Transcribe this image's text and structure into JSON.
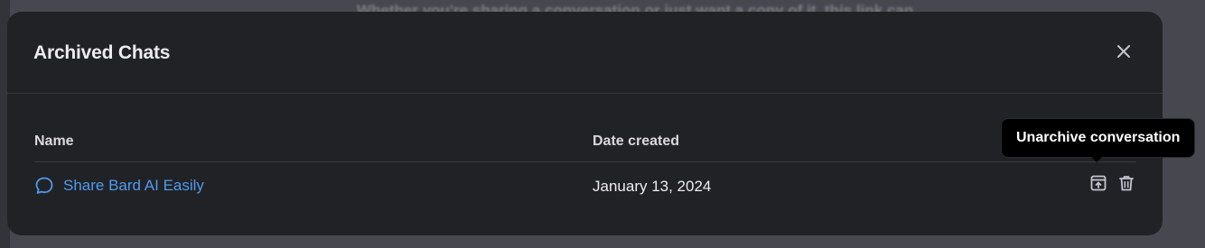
{
  "backdrop": {
    "text": "Whether you're sharing a conversation or just want a copy of it, this link can"
  },
  "modal": {
    "title": "Archived Chats",
    "close_icon": "close-icon"
  },
  "table": {
    "columns": [
      "Name",
      "Date created"
    ],
    "rows": [
      {
        "name": "Share Bard AI Easily",
        "date_created": "January 13, 2024",
        "icon": "chat-bubble-icon"
      }
    ]
  },
  "actions": {
    "unarchive_icon": "unarchive-icon",
    "delete_icon": "trash-icon"
  },
  "tooltip": {
    "text": "Unarchive conversation"
  },
  "colors": {
    "link": "#4d9bef",
    "modal_bg": "#212225",
    "tooltip_bg": "#000000"
  }
}
